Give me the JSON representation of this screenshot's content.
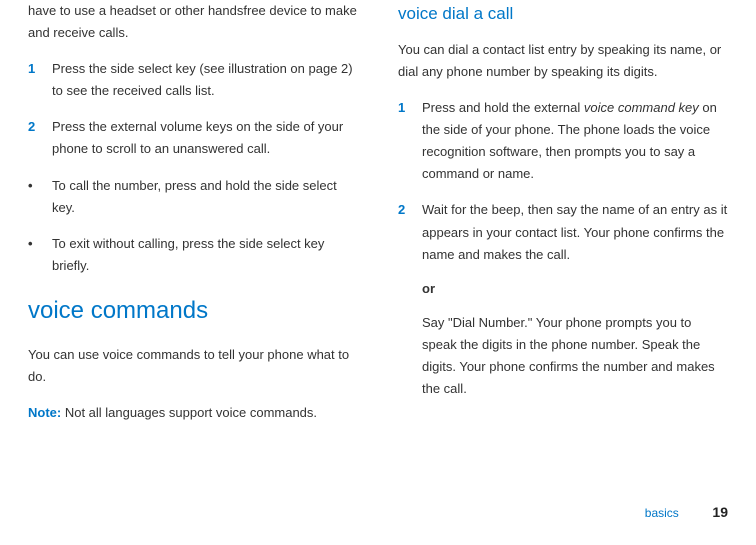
{
  "left": {
    "intro": "have to use a headset or other handsfree device to make and receive calls.",
    "step1_num": "1",
    "step1": "Press the side select key (see illustration on page 2) to see the received calls list.",
    "step2_num": "2",
    "step2": "Press the external volume keys on the side of your phone to scroll to an unanswered call.",
    "bullet_char": "•",
    "bullet1": "To call the number, press and hold the side select key.",
    "bullet2": "To exit without calling, press the side select key briefly.",
    "heading": "voice commands",
    "desc": "You can use voice commands to tell your phone what to do.",
    "note_label": "Note:",
    "note_text": " Not all languages support voice commands."
  },
  "right": {
    "heading": "voice dial a call",
    "desc": "You can dial a contact list entry by speaking its name, or dial any phone number by speaking its digits.",
    "step1_num": "1",
    "step1_a": "Press and hold the external ",
    "step1_i": "voice command key",
    "step1_b": " on the side of your phone. The phone loads the voice recognition software, then prompts you to say a command or name.",
    "step2_num": "2",
    "step2": "Wait for the beep, then say the name of an entry as it appears in your contact list. Your phone confirms the name and makes the call.",
    "or": "or",
    "alt": "Say \"Dial Number.\" Your phone prompts you to speak the digits in the phone number. Speak the digits. Your phone confirms the number and makes the call."
  },
  "footer": {
    "section": "basics",
    "page": "19"
  }
}
